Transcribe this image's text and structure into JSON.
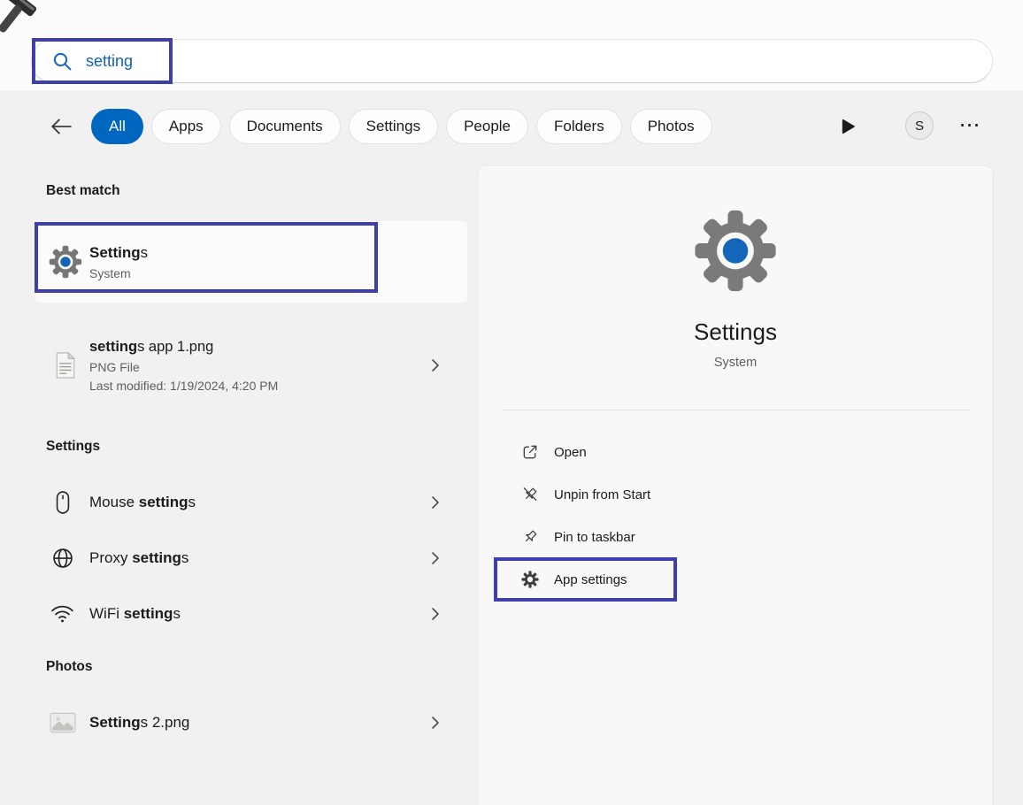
{
  "colors": {
    "annotation": "#3e3ead",
    "selected_tab": "#0067c0",
    "search_text": "#0f62b8",
    "gear_gray": "#7a7a7a",
    "gear_blue": "#1466b8"
  },
  "search": {
    "value": "setting",
    "icon": "search-icon"
  },
  "filters": {
    "back_icon": "back-arrow-icon",
    "tabs": [
      {
        "label": "All",
        "selected": true
      },
      {
        "label": "Apps",
        "selected": false
      },
      {
        "label": "Documents",
        "selected": false
      },
      {
        "label": "Settings",
        "selected": false
      },
      {
        "label": "People",
        "selected": false
      },
      {
        "label": "Folders",
        "selected": false
      },
      {
        "label": "Photos",
        "selected": false
      }
    ],
    "play_icon": "play-icon",
    "avatar_letter": "S",
    "more_glyph": "⋯"
  },
  "left": {
    "best_match_heading": "Best match",
    "best_match": {
      "icon": "settings-gear-icon",
      "name_bold": "Setting",
      "name_rest": "s",
      "subtitle": "System"
    },
    "file_result": {
      "icon": "file-icon",
      "name_bold": "setting",
      "name_rest": "s app 1.png",
      "file_type": "PNG File",
      "modified": "Last modified: 1/19/2024, 4:20 PM"
    },
    "settings_heading": "Settings",
    "quick_settings": [
      {
        "icon": "mouse-icon",
        "pre": "Mouse ",
        "bold": "setting",
        "post": "s"
      },
      {
        "icon": "globe-icon",
        "pre": "Proxy ",
        "bold": "setting",
        "post": "s"
      },
      {
        "icon": "wifi-icon",
        "pre": "WiFi ",
        "bold": "setting",
        "post": "s"
      }
    ],
    "photos_heading": "Photos",
    "photo_result": {
      "icon": "image-icon",
      "name_bold": "Setting",
      "name_rest": "s 2.png"
    }
  },
  "right": {
    "app_icon": "settings-gear-icon",
    "app_name": "Settings",
    "app_type": "System",
    "actions": [
      {
        "icon": "open-icon",
        "label": "Open"
      },
      {
        "icon": "unpin-icon",
        "label": "Unpin from Start"
      },
      {
        "icon": "pin-icon",
        "label": "Pin to taskbar"
      },
      {
        "icon": "gear-icon",
        "label": "App settings",
        "highlighted": true
      }
    ]
  }
}
